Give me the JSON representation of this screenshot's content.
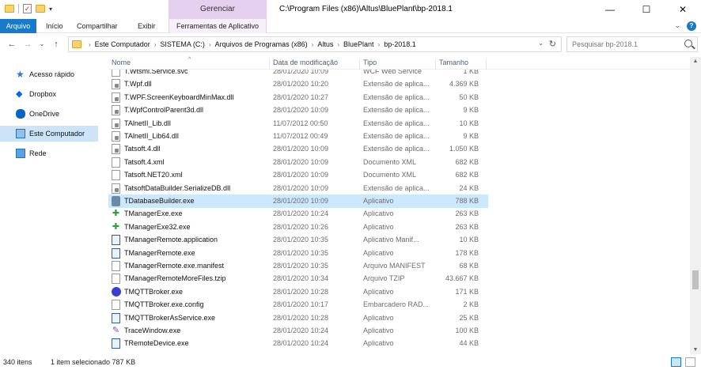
{
  "window": {
    "title_path": "C:\\Program Files (x86)\\Altus\\BluePlant\\bp-2018.1",
    "context_group": "Gerenciar",
    "controls": {
      "minimize": "—",
      "maximize": "☐",
      "close": "✕"
    }
  },
  "ribbon": {
    "tabs": [
      "Arquivo",
      "Início",
      "Compartilhar",
      "Exibir"
    ],
    "context_tab": "Ferramentas de Aplicativo",
    "expand_glyph": "⌄",
    "help_glyph": "?"
  },
  "address": {
    "breadcrumbs": [
      "Este Computador",
      "SISTEMA  (C:)",
      "Arquivos de Programas (x86)",
      "Altus",
      "BluePlant",
      "bp-2018.1"
    ],
    "search_placeholder": "Pesquisar bp-2018.1"
  },
  "nav": {
    "items": [
      {
        "label": "Acesso rápido",
        "icon": "star-icon"
      },
      {
        "label": "Dropbox",
        "icon": "dropbox-icon"
      },
      {
        "label": "OneDrive",
        "icon": "cloud-icon"
      },
      {
        "label": "Este Computador",
        "icon": "computer-icon",
        "selected": true
      },
      {
        "label": "Rede",
        "icon": "network-icon"
      }
    ]
  },
  "columns": {
    "name": "Nome",
    "date": "Data de modificação",
    "type": "Tipo",
    "size": "Tamanho"
  },
  "files": [
    {
      "name": "T.Wtsmi.Service.svc",
      "date": "28/01/2020 10:09",
      "type": "WCF Web Service",
      "size": "1 KB",
      "icon": "doc"
    },
    {
      "name": "T.Wpf.dll",
      "date": "28/01/2020 10:20",
      "type": "Extensão de aplica...",
      "size": "4.369 KB",
      "icon": "dll"
    },
    {
      "name": "T.WPF.ScreenKeyboardMinMax.dll",
      "date": "28/01/2020 10:27",
      "type": "Extensão de aplica...",
      "size": "50 KB",
      "icon": "dll"
    },
    {
      "name": "T.WpfControlParent3d.dll",
      "date": "28/01/2020 10:09",
      "type": "Extensão de aplica...",
      "size": "9 KB",
      "icon": "dll"
    },
    {
      "name": "TAlnetII_Lib.dll",
      "date": "11/07/2012 00:50",
      "type": "Extensão de aplica...",
      "size": "10 KB",
      "icon": "dll"
    },
    {
      "name": "TAlnetII_Lib64.dll",
      "date": "11/07/2012 00:49",
      "type": "Extensão de aplica...",
      "size": "9 KB",
      "icon": "dll"
    },
    {
      "name": "Tatsoft.4.dll",
      "date": "28/01/2020 10:09",
      "type": "Extensão de aplica...",
      "size": "1.050 KB",
      "icon": "dll"
    },
    {
      "name": "Tatsoft.4.xml",
      "date": "28/01/2020 10:09",
      "type": "Documento XML",
      "size": "682 KB",
      "icon": "doc"
    },
    {
      "name": "Tatsoft.NET20.xml",
      "date": "28/01/2020 10:09",
      "type": "Documento XML",
      "size": "682 KB",
      "icon": "doc"
    },
    {
      "name": "TatsoftDataBuilder.SerializeDB.dll",
      "date": "28/01/2020 10:09",
      "type": "Extensão de aplica...",
      "size": "24 KB",
      "icon": "dll"
    },
    {
      "name": "TDatabaseBuilder.exe",
      "date": "28/01/2020 10:09",
      "type": "Aplicativo",
      "size": "788 KB",
      "icon": "exe-hammer",
      "selected": true
    },
    {
      "name": "TManagerExe.exe",
      "date": "28/01/2020 10:24",
      "type": "Aplicativo",
      "size": "263 KB",
      "icon": "exe-green"
    },
    {
      "name": "TManagerExe32.exe",
      "date": "28/01/2020 10:26",
      "type": "Aplicativo",
      "size": "263 KB",
      "icon": "exe-green"
    },
    {
      "name": "TManagerRemote.application",
      "date": "28/01/2020 10:35",
      "type": "Aplicativo Manif...",
      "size": "10 KB",
      "icon": "app"
    },
    {
      "name": "TManagerRemote.exe",
      "date": "28/01/2020 10:35",
      "type": "Aplicativo",
      "size": "178 KB",
      "icon": "app"
    },
    {
      "name": "TManagerRemote.exe.manifest",
      "date": "28/01/2020 10:35",
      "type": "Arquivo MANIFEST",
      "size": "68 KB",
      "icon": "doc"
    },
    {
      "name": "TManagerRemoteMoreFiles.tzip",
      "date": "28/01/2020 10:34",
      "type": "Arquivo TZIP",
      "size": "43.667 KB",
      "icon": "doc"
    },
    {
      "name": "TMQTTBroker.exe",
      "date": "28/01/2020 10:28",
      "type": "Aplicativo",
      "size": "171 KB",
      "icon": "blue-circle"
    },
    {
      "name": "TMQTTBroker.exe.config",
      "date": "28/01/2020 10:17",
      "type": "Embarcadero RAD...",
      "size": "2 KB",
      "icon": "doc"
    },
    {
      "name": "TMQTTBrokerAsService.exe",
      "date": "28/01/2020 10:28",
      "type": "Aplicativo",
      "size": "25 KB",
      "icon": "app"
    },
    {
      "name": "TraceWindow.exe",
      "date": "28/01/2020 10:24",
      "type": "Aplicativo",
      "size": "100 KB",
      "icon": "trace"
    },
    {
      "name": "TRemoteDevice.exe",
      "date": "28/01/2020 10:24",
      "type": "Aplicativo",
      "size": "44 KB",
      "icon": "app"
    }
  ],
  "status": {
    "count": "340 itens",
    "selection": "1 item selecionado  787 KB"
  }
}
